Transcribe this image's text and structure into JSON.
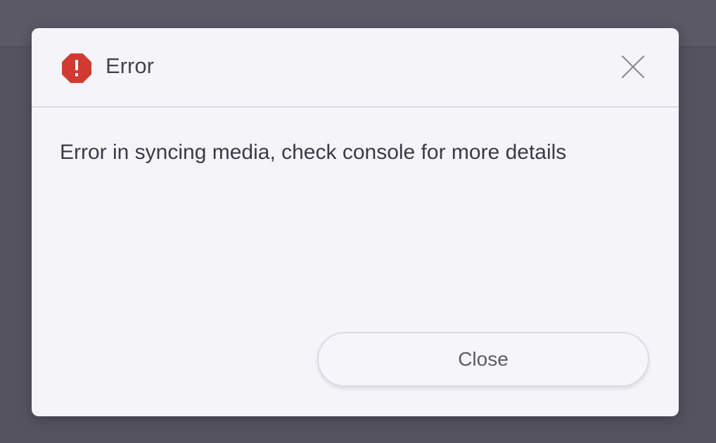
{
  "dialog": {
    "title": "Error",
    "message": "Error in syncing media, check console for more details",
    "close_button_label": "Close",
    "icons": {
      "status": "error-icon",
      "dismiss": "close-icon"
    }
  },
  "colors": {
    "error_red": "#d13a31",
    "backdrop": "#55535f",
    "dialog_bg": "#f5f5f9"
  }
}
